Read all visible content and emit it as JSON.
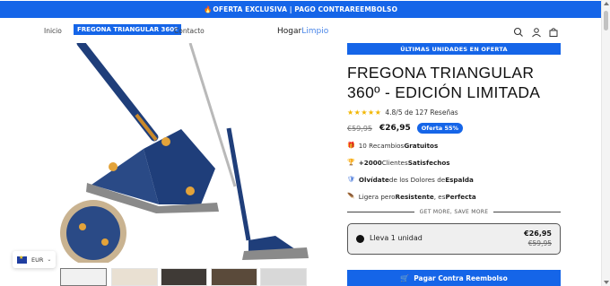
{
  "announcement": {
    "icon": "fire-icon",
    "text": "OFERTA EXCLUSIVA | PAGO CONTRAREEMBOLSO"
  },
  "nav": {
    "links": [
      "Inicio",
      "FREGONA TRIANGULAR 360º",
      "Contacto"
    ]
  },
  "logo": {
    "part1": "Hogar",
    "part2": "Limpio"
  },
  "header_icons": [
    "search-icon",
    "account-icon",
    "cart-icon"
  ],
  "currency": {
    "code": "EUR"
  },
  "product": {
    "urgency": "ÚLTIMAS UNIDADES EN OFERTA",
    "title": "FREGONA TRIANGULAR 360º - EDICIÓN LIMITADA",
    "rating_stars": "★★★★★",
    "rating_text": "4.8/5 de 127 Reseñas",
    "old_price": "€59,95",
    "new_price": "€26,95",
    "badge": "Oferta 55%",
    "features": [
      {
        "icon": "gift-icon",
        "text": "10 Recambios ",
        "bold": "Gratuitos",
        "after": ""
      },
      {
        "icon": "trophy-icon",
        "text": "",
        "bold": "+2000",
        "middle": " Clientes ",
        "bold2": "Satisfechos"
      },
      {
        "icon": "shield-icon",
        "text": "",
        "bold": "Olvídate",
        "middle": " de los Dolores de ",
        "bold2": "Espalda"
      },
      {
        "icon": "feather-icon",
        "text": "Ligera pero ",
        "bold": "Resistente",
        "middle": ", es ",
        "bold2": "Perfecta"
      }
    ],
    "divider": "GET MORE, SAVE MORE",
    "option": {
      "label": "Lleva 1 unidad",
      "new_price": "€26,95",
      "old_price": "€59,95"
    },
    "cta": "Pagar Contra Reembolso"
  },
  "colors": {
    "accent": "#1565e8",
    "mop_head": "#1f3e7a",
    "mop_fiber": "#8a8a8a",
    "handle": "#b9b9b9"
  }
}
